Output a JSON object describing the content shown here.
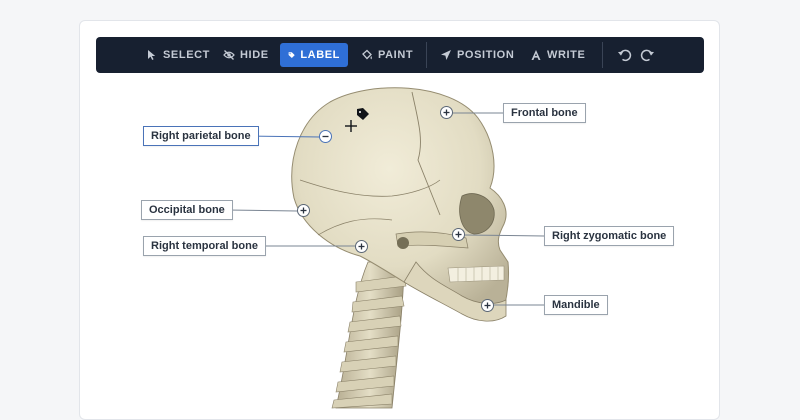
{
  "toolbar": {
    "tools": [
      {
        "label": "SELECT",
        "icon": "cursor-icon"
      },
      {
        "label": "HIDE",
        "icon": "eye-slash-icon"
      },
      {
        "label": "LABEL",
        "icon": "tag-icon",
        "active": true
      },
      {
        "label": "PAINT",
        "icon": "paint-bucket-icon"
      },
      {
        "label": "POSITION",
        "icon": "location-arrow-icon"
      },
      {
        "label": "WRITE",
        "icon": "text-a-icon"
      }
    ],
    "undo_icon": "undo-icon",
    "redo_icon": "redo-icon"
  },
  "labels": {
    "right_parietal": "Right parietal bone",
    "frontal": "Frontal bone",
    "occipital": "Occipital bone",
    "right_temporal": "Right temporal bone",
    "right_zygomatic": "Right zygomatic bone",
    "mandible": "Mandible"
  },
  "colors": {
    "toolbar_bg": "#172030",
    "active_tool": "#2f6fd6",
    "selected_label": "#4a73b8",
    "bone": "#e2dcc3"
  }
}
